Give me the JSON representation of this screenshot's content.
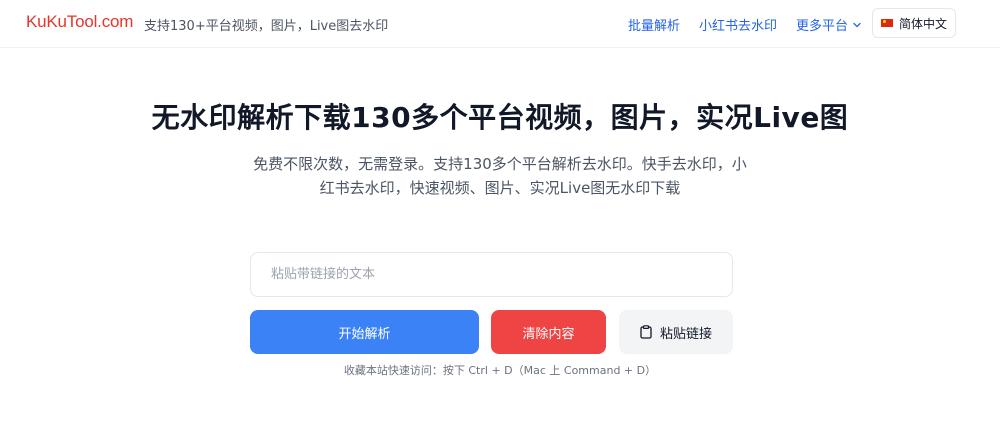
{
  "header": {
    "logo": "KuKuTool.com",
    "tagline": "支持130+平台视频，图片，Live图去水印",
    "nav": {
      "batch": "批量解析",
      "xiaohongshu": "小红书去水印",
      "more": "更多平台"
    },
    "language": "简体中文"
  },
  "hero": {
    "title": "无水印解析下载130多个平台视频，图片，实况Live图",
    "subtitle": "免费不限次数，无需登录。支持130多个平台解析去水印。快手去水印，小红书去水印，快速视频、图片、实况Live图无水印下载"
  },
  "form": {
    "input_value": "",
    "input_placeholder": "粘贴带链接的文本",
    "parse_label": "开始解析",
    "clear_label": "清除内容",
    "paste_label": "粘贴链接",
    "hint": "收藏本站快速访问：按下 Ctrl + D（Mac 上 Command + D）"
  },
  "colors": {
    "brand": "#e8342a",
    "link": "#2563eb",
    "primary": "#3b82f6",
    "danger": "#ef4444"
  },
  "icons": {
    "more_chevron": "chevron-down-icon",
    "language_flag": "china-flag-icon",
    "paste": "clipboard-icon"
  }
}
